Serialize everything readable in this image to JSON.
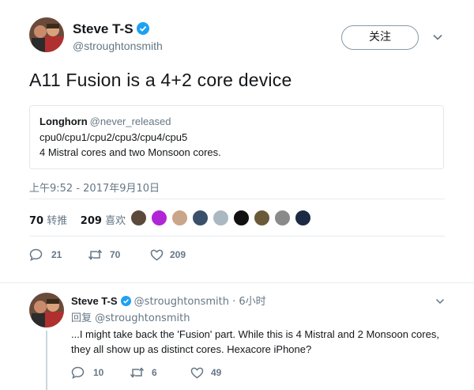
{
  "tweet": {
    "author": {
      "name": "Steve T-S",
      "handle": "@stroughtonsmith",
      "verified": true
    },
    "follow_label": "关注",
    "text": "A11 Fusion is a 4+2 core device",
    "quote": {
      "name": "Longhorn",
      "handle": "@never_released",
      "line1": "cpu0/cpu1/cpu2/cpu3/cpu4/cpu5",
      "line2": "4 Mistral cores and two Monsoon cores."
    },
    "timestamp": "上午9:52 - 2017年9月10日",
    "stats": {
      "retweets": "70",
      "retweets_label": "转推",
      "likes": "209",
      "likes_label": "喜欢"
    },
    "actions": {
      "replies": "21",
      "retweets": "70",
      "likes": "209"
    }
  },
  "reply": {
    "author": {
      "name": "Steve T-S",
      "handle": "@stroughtonsmith",
      "verified": true
    },
    "time": "6小时",
    "replying_to_label": "回复",
    "replying_to_handle": "@stroughtonsmith",
    "text": "...I might take back the 'Fusion' part. While this is 4 Mistral and 2 Monsoon cores, they all show up as distinct cores. Hexacore iPhone?",
    "actions": {
      "replies": "10",
      "retweets": "6",
      "likes": "49"
    }
  },
  "colors": {
    "accent": "#1da1f2",
    "muted": "#657786",
    "border": "#e1e8ed"
  },
  "liker_faces": [
    {
      "name": "liker-avatar-1",
      "color": "#5b4a3c"
    },
    {
      "name": "liker-avatar-2",
      "color": "#b026d6"
    },
    {
      "name": "liker-avatar-3",
      "color": "#c9a58a"
    },
    {
      "name": "liker-avatar-4",
      "color": "#3a4f6a"
    },
    {
      "name": "liker-avatar-5",
      "color": "#aab8c2"
    },
    {
      "name": "liker-avatar-6",
      "color": "#111111"
    },
    {
      "name": "liker-avatar-7",
      "color": "#6b5a3a"
    },
    {
      "name": "liker-avatar-8",
      "color": "#8a8a8a"
    },
    {
      "name": "liker-avatar-9",
      "color": "#1c2a44"
    }
  ]
}
